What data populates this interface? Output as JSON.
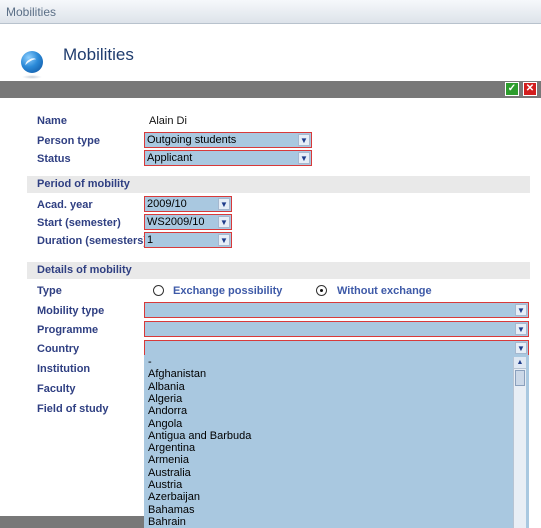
{
  "window": {
    "title": "Mobilities"
  },
  "header": {
    "title": "Mobilities",
    "globe_icon": "globe-icon"
  },
  "toolbar": {
    "ok_icon": "save-check-icon",
    "close_icon": "delete-close-icon",
    "ok_color": "#2d9d2d",
    "close_color": "#d21e1e"
  },
  "person": {
    "name_label": "Name",
    "name_value": "Alain Di",
    "type_label": "Person type",
    "type_value": "Outgoing students",
    "status_label": "Status",
    "status_value": "Applicant"
  },
  "period": {
    "section": "Period of mobility",
    "acad_year_label": "Acad. year",
    "acad_year_value": "2009/10",
    "start_label": "Start (semester)",
    "start_value": "WS2009/10",
    "duration_label": "Duration (semesters)",
    "duration_value": "1"
  },
  "details": {
    "section": "Details of mobility",
    "type_label": "Type",
    "option_exchange": "Exchange possibility",
    "option_without": "Without exchange",
    "selected": "Without exchange",
    "mobility_type_label": "Mobility type",
    "mobility_type_value": "",
    "programme_label": "Programme",
    "programme_value": "",
    "country_label": "Country",
    "country_value": "",
    "institution_label": "Institution",
    "faculty_label": "Faculty",
    "field_label": "Field of study"
  },
  "country_options": [
    "-",
    "Afghanistan",
    "Albania",
    "Algeria",
    "Andorra",
    "Angola",
    "Antigua and Barbuda",
    "Argentina",
    "Armenia",
    "Australia",
    "Austria",
    "Azerbaijan",
    "Bahamas",
    "Bahrain"
  ],
  "colors": {
    "field_bg": "#a9c8e0",
    "required_border": "#d83a3a",
    "label": "#2f3f82"
  }
}
